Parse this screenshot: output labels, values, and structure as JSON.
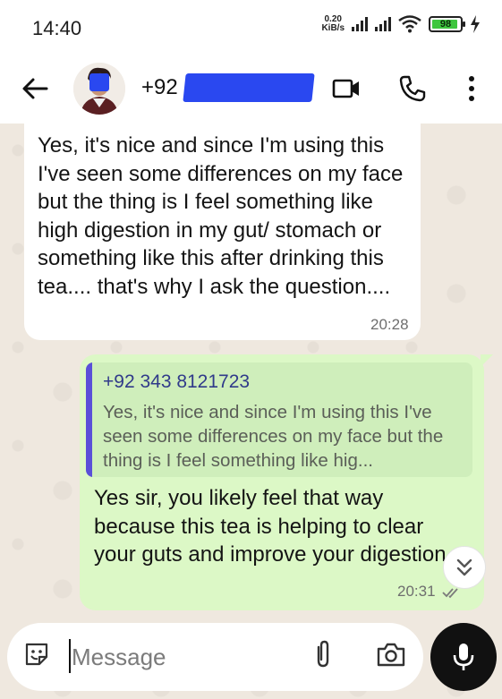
{
  "status_bar": {
    "time": "14:40",
    "net_speed_value": "0.20",
    "net_speed_unit": "KiB/s",
    "battery_level": "98",
    "charging_icon": "bolt-icon"
  },
  "header": {
    "contact_name": "+92",
    "icons": [
      "back-arrow-icon",
      "avatar",
      "video-call-icon",
      "phone-icon",
      "more-vertical-icon"
    ]
  },
  "messages": {
    "incoming": {
      "text": "Yes, it's nice and since I'm using this I've seen some differences on my face but the thing is I feel something like high digestion in my gut/ stomach or something like this after drinking this tea.... that's why I ask the question....",
      "time": "20:28"
    },
    "outgoing": {
      "quote_author": "+92 343 8121723",
      "quote_text": "Yes, it's nice and since I'm using this I've seen some differences on my face but the thing is I feel something like hig...",
      "text": "Yes sir, you likely feel that way because this tea is helping to clear your  guts and improve your digestion.",
      "time": "20:31"
    }
  },
  "composer": {
    "placeholder": "Message",
    "icons": [
      "emoji-icon",
      "attach-icon",
      "camera-icon",
      "mic-icon"
    ]
  },
  "colors": {
    "chat_background": "#efe8df",
    "outgoing_bubble": "#dcf8c6",
    "quote_bar": "#5a4fd8",
    "redaction": "#2a48f0"
  }
}
